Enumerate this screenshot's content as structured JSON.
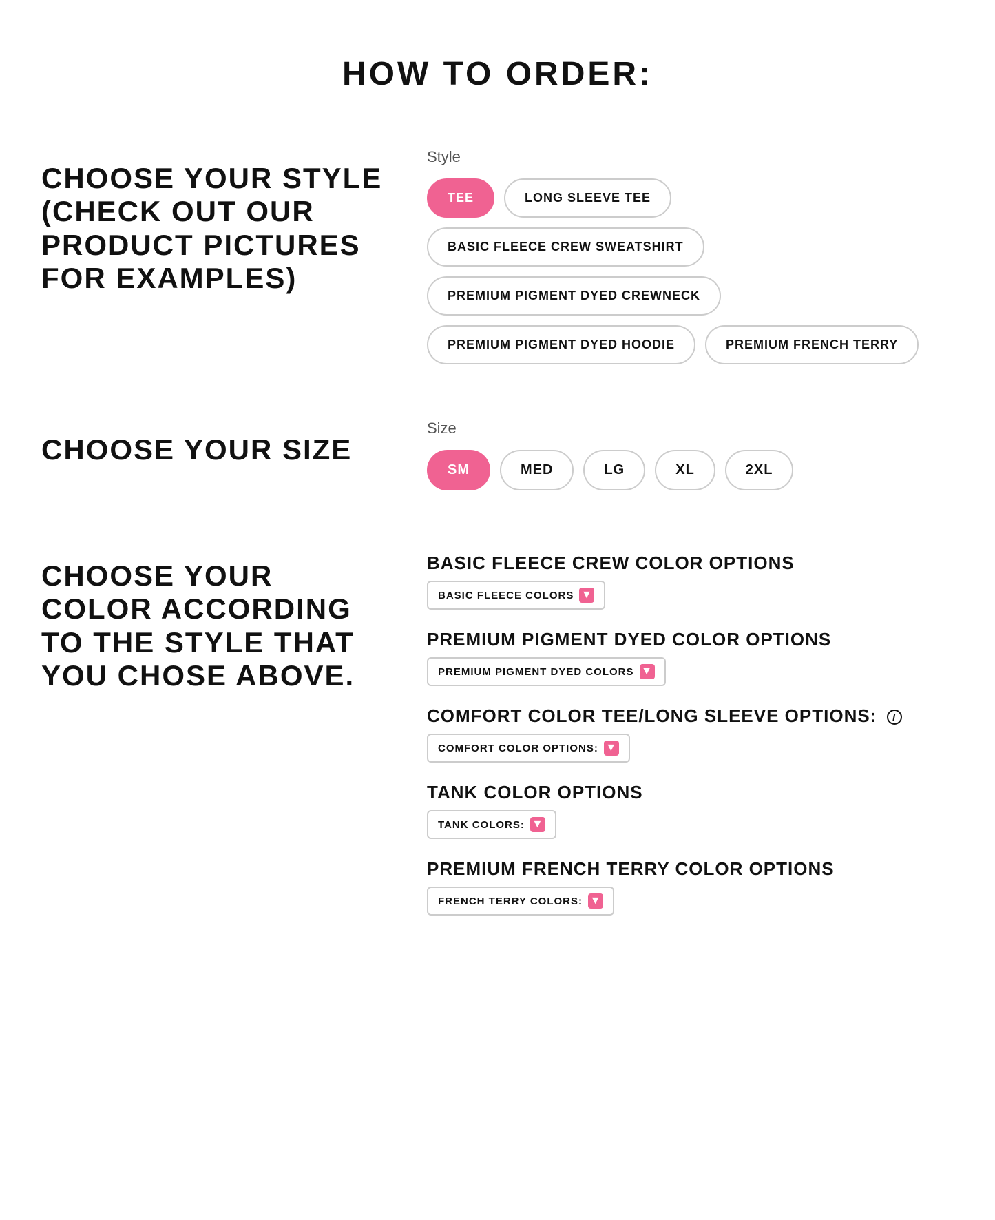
{
  "page": {
    "title": "HOW TO ORDER:",
    "sections": [
      {
        "id": "choose-style",
        "left_label": "CHOOSE YOUR STYLE (CHECK OUT OUR PRODUCT PICTURES FOR EXAMPLES)",
        "right": {
          "label": "Style",
          "options": [
            {
              "id": "tee",
              "label": "TEE",
              "active": true
            },
            {
              "id": "long-sleeve-tee",
              "label": "LONG SLEEVE TEE",
              "active": false
            },
            {
              "id": "basic-fleece-crew-sweatshirt",
              "label": "BASIC FLEECE CREW SWEATSHIRT",
              "active": false
            },
            {
              "id": "premium-pigment-dyed-crewneck",
              "label": "PREMIUM PIGMENT DYED CREWNECK",
              "active": false
            },
            {
              "id": "premium-pigment-dyed-hoodie",
              "label": "PREMIUM PIGMENT DYED HOODIE",
              "active": false
            },
            {
              "id": "premium-french-terry",
              "label": "PREMIUM FRENCH TERRY",
              "active": false
            }
          ]
        }
      },
      {
        "id": "choose-size",
        "left_label": "CHOOSE YOUR SIZE",
        "right": {
          "label": "Size",
          "options": [
            {
              "id": "sm",
              "label": "SM",
              "active": true
            },
            {
              "id": "med",
              "label": "MED",
              "active": false
            },
            {
              "id": "lg",
              "label": "LG",
              "active": false
            },
            {
              "id": "xl",
              "label": "XL",
              "active": false
            },
            {
              "id": "2xl",
              "label": "2XL",
              "active": false
            }
          ]
        }
      }
    ],
    "color_section": {
      "left_label": "CHOOSE YOUR COLOR ACCORDING TO THE STYLE THAT YOU CHOSE ABOVE.",
      "groups": [
        {
          "id": "basic-fleece-crew",
          "title": "BASIC FLEECE CREW COLOR OPTIONS",
          "has_info": false,
          "dropdown_label": "BASIC FLEECE COLORS"
        },
        {
          "id": "premium-pigment-dyed",
          "title": "PREMIUM PIGMENT DYED COLOR OPTIONS",
          "has_info": false,
          "dropdown_label": "PREMIUM PIGMENT DYED COLORS"
        },
        {
          "id": "comfort-color",
          "title": "COMFORT COLOR TEE/LONG SLEEVE OPTIONS:",
          "has_info": true,
          "dropdown_label": "COMFORT COLOR OPTIONS:"
        },
        {
          "id": "tank",
          "title": "TANK COLOR OPTIONS",
          "has_info": false,
          "dropdown_label": "TANK COLORS:"
        },
        {
          "id": "french-terry",
          "title": "PREMIUM FRENCH TERRY COLOR OPTIONS",
          "has_info": false,
          "dropdown_label": "FRENCH TERRY COLORS:"
        }
      ]
    }
  }
}
